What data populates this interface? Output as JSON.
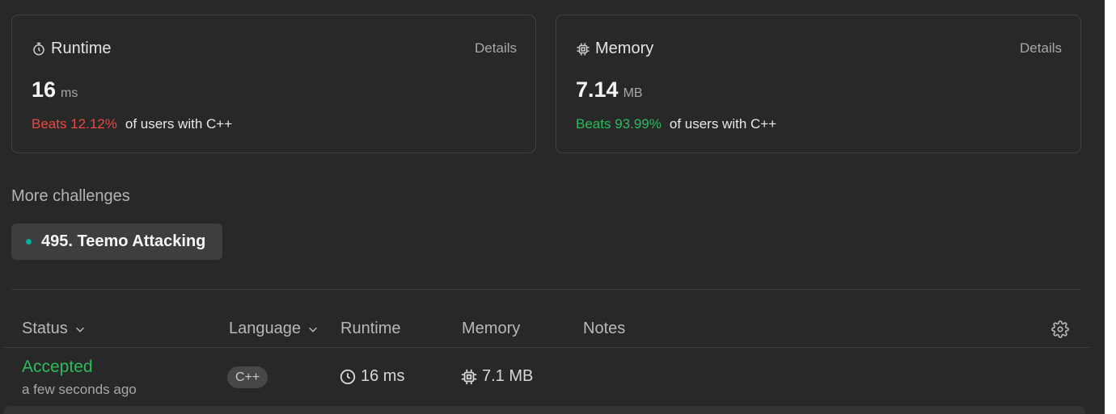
{
  "runtime_card": {
    "title": "Runtime",
    "icon": "stopwatch-icon",
    "details_label": "Details",
    "value": "16",
    "unit": "ms",
    "beats_text": "Beats 12.12%",
    "beats_suffix": "of users with C++",
    "beats_color": "#ef4743"
  },
  "memory_card": {
    "title": "Memory",
    "icon": "chip-icon",
    "details_label": "Details",
    "value": "7.14",
    "unit": "MB",
    "beats_text": "Beats 93.99%",
    "beats_suffix": "of users with C++",
    "beats_color": "#2cbb5d"
  },
  "more_challenges": {
    "title": "More challenges",
    "items": [
      {
        "label": "495. Teemo Attacking",
        "dot_color": "#00af9b"
      }
    ]
  },
  "table": {
    "columns": {
      "status": "Status",
      "language": "Language",
      "runtime": "Runtime",
      "memory": "Memory",
      "notes": "Notes"
    },
    "rows": [
      {
        "status": "Accepted",
        "time": "a few seconds ago",
        "language": "C++",
        "runtime": "16 ms",
        "memory": "7.1 MB",
        "status_color": "#2cbb5d"
      }
    ]
  }
}
